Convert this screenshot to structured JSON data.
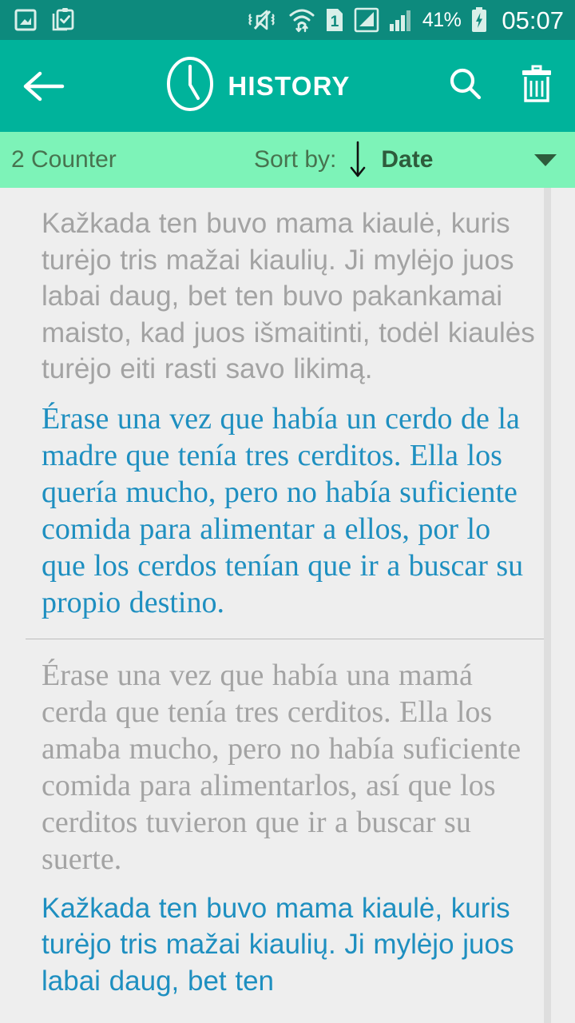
{
  "status_bar": {
    "icons_left": [
      "image-icon",
      "clipboard-check-icon"
    ],
    "icons_right": [
      "vibrate-mute-icon",
      "wifi-transfer-icon",
      "sim-1-icon",
      "signal-bars-boxed-icon",
      "signal-bars-icon"
    ],
    "battery_percent": "41%",
    "battery_icon": "battery-charging-icon",
    "clock": "05:07",
    "background_color": "#0d8a7d"
  },
  "toolbar": {
    "back_icon": "arrow-left-icon",
    "clock_icon": "clock-icon",
    "title": "HISTORY",
    "search_icon": "search-icon",
    "delete_icon": "trash-icon",
    "background_color": "#00b39b"
  },
  "sort_bar": {
    "counter_label": "2 Counter",
    "sort_by_label": "Sort by:",
    "direction_icon": "arrow-down-icon",
    "sort_value": "Date",
    "dropdown_icon": "caret-down-icon",
    "background_color": "#7df3b8"
  },
  "list": {
    "items": [
      {
        "source_text": "Kažkada ten buvo mama kiaulė, kuris turėjo tris mažai kiaulių. Ji mylėjo juos labai daug, bet ten buvo pakankamai maisto, kad juos išmaitinti, todėl kiaulės turėjo eiti rasti savo likimą.",
        "translated_text": "Érase una vez que había un cerdo de la madre que tenía tres cerditos. Ella los quería mucho, pero no había suficiente comida para alimentar a ellos, por lo que los cerdos tenían que ir a buscar su propio destino."
      },
      {
        "source_text": "Érase una vez que había una mamá cerda que tenía tres cerditos. Ella los amaba mucho, pero no había suficiente comida para alimentarlos, así que los cerditos tuvieron que ir a buscar su suerte.",
        "translated_text": "Kažkada ten buvo mama kiaulė, kuris turėjo tris mažai kiaulių. Ji mylėjo juos labai daug, bet ten"
      }
    ],
    "source_text_color": "#a3a3a3",
    "translated_text_color": "#1e8fc0",
    "background_color": "#eeeeee"
  }
}
